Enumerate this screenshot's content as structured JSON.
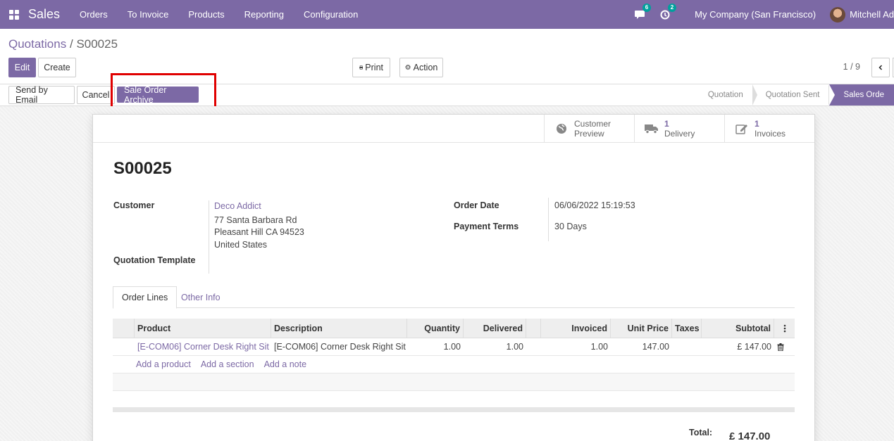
{
  "navbar": {
    "app_name": "Sales",
    "menu": [
      "Orders",
      "To Invoice",
      "Products",
      "Reporting",
      "Configuration"
    ],
    "messages_count": "6",
    "activities_count": "2",
    "company": "My Company (San Francisco)",
    "user": "Mitchell Ad"
  },
  "breadcrumb": {
    "parent": "Quotations",
    "separator": "/",
    "current": "S00025"
  },
  "actions": {
    "edit": "Edit",
    "create": "Create",
    "print": "Print",
    "action": "Action",
    "pager": "1 / 9"
  },
  "statusbar": {
    "send_by_email": "Send by Email",
    "cancel": "Cancel",
    "archive": "Sale Order Archive",
    "stages": [
      "Quotation",
      "Quotation Sent",
      "Sales Orde"
    ]
  },
  "smart_buttons": {
    "preview_line1": "Customer",
    "preview_line2": "Preview",
    "delivery_count": "1",
    "delivery_label": "Delivery",
    "invoices_count": "1",
    "invoices_label": "Invoices"
  },
  "order": {
    "name": "S00025",
    "customer_label": "Customer",
    "customer_name": "Deco Addict",
    "address_line1": "77 Santa Barbara Rd",
    "address_line2": "Pleasant Hill CA 94523",
    "address_line3": "United States",
    "template_label": "Quotation Template",
    "order_date_label": "Order Date",
    "order_date": "06/06/2022 15:19:53",
    "payment_terms_label": "Payment Terms",
    "payment_terms": "30 Days"
  },
  "tabs": [
    "Order Lines",
    "Other Info"
  ],
  "lines": {
    "columns": {
      "product": "Product",
      "description": "Description",
      "quantity": "Quantity",
      "delivered": "Delivered",
      "invoiced": "Invoiced",
      "unit_price": "Unit Price",
      "taxes": "Taxes",
      "subtotal": "Subtotal"
    },
    "rows": [
      {
        "product": "[E-COM06] Corner Desk Right Sit",
        "description": "[E-COM06] Corner Desk Right Sit",
        "quantity": "1.00",
        "delivered": "1.00",
        "invoiced": "1.00",
        "unit_price": "147.00",
        "taxes": "",
        "subtotal": "£ 147.00"
      }
    ],
    "add_product": "Add a product",
    "add_section": "Add a section",
    "add_note": "Add a note"
  },
  "totals": {
    "label": "Total:",
    "value": "£ 147.00"
  },
  "colors": {
    "brand": "#7c69a5",
    "highlight": "#e00000",
    "badge": "#00a09d"
  }
}
